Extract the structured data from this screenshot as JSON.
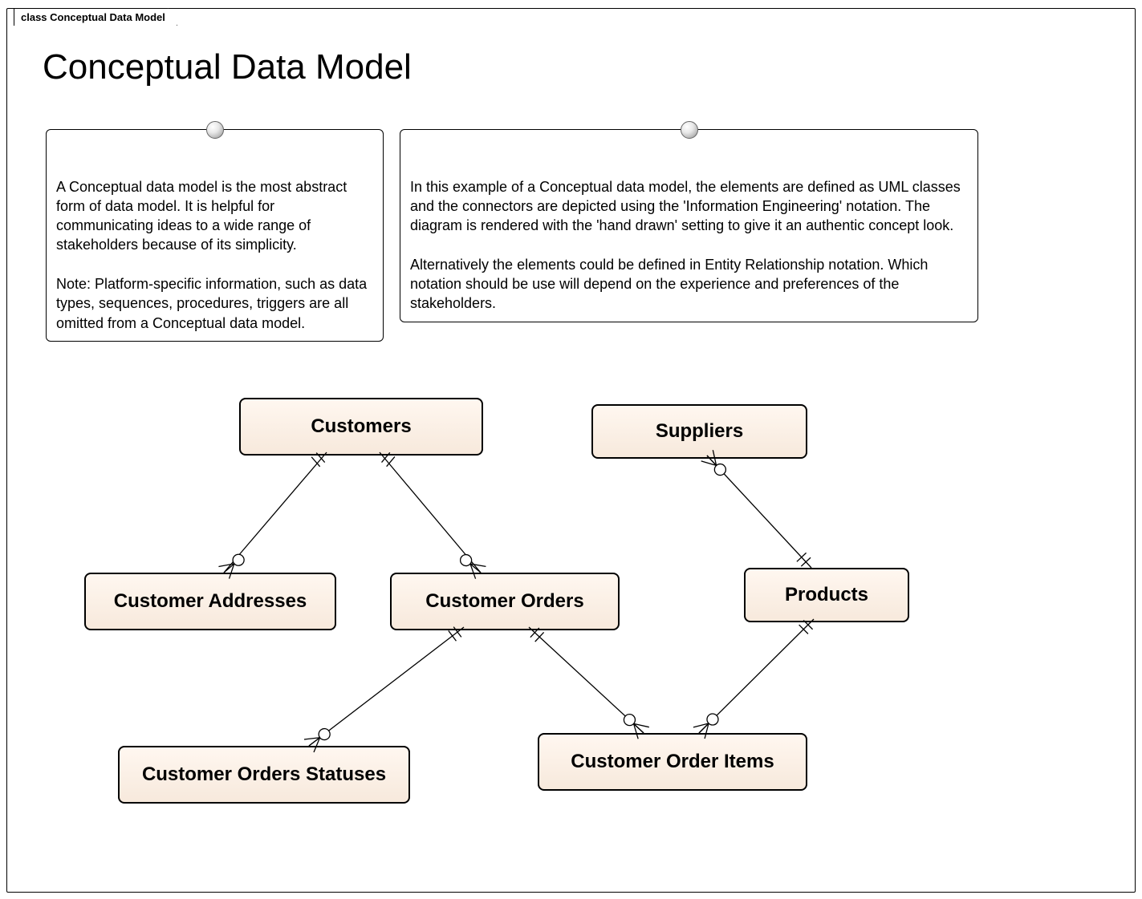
{
  "diagram": {
    "tab_label": "class Conceptual Data Model",
    "title": "Conceptual Data Model",
    "notes": {
      "left": "A Conceptual data model is the most abstract form of data model. It is helpful for communicating ideas to a wide range of stakeholders because of its simplicity.\n\nNote: Platform-specific information, such as data types, sequences, procedures, triggers are all omitted from a Conceptual data model.",
      "right": "In this example of a Conceptual data model, the elements are defined as UML classes and the connectors are depicted using the 'Information Engineering' notation.  The diagram is rendered with the 'hand drawn' setting to give it an authentic concept look.\n\nAlternatively  the elements could be defined in Entity Relationship notation. Which notation should be use will depend on the experience and preferences of the stakeholders."
    },
    "entities": {
      "customers": "Customers",
      "suppliers": "Suppliers",
      "customer_addresses": "Customer Addresses",
      "customer_orders": "Customer Orders",
      "products": "Products",
      "customer_orders_statuses": "Customer Orders Statuses",
      "customer_order_items": "Customer Order Items"
    },
    "relationships": [
      {
        "from": "customers",
        "to": "customer_addresses",
        "from_card": "one",
        "to_card": "zero-or-many"
      },
      {
        "from": "customers",
        "to": "customer_orders",
        "from_card": "one",
        "to_card": "zero-or-many"
      },
      {
        "from": "suppliers",
        "to": "products",
        "from_card": "zero-or-many",
        "to_card": "one"
      },
      {
        "from": "customer_orders",
        "to": "customer_orders_statuses",
        "from_card": "one",
        "to_card": "zero-or-many"
      },
      {
        "from": "customer_orders",
        "to": "customer_order_items",
        "from_card": "one",
        "to_card": "zero-or-many"
      },
      {
        "from": "products",
        "to": "customer_order_items",
        "from_card": "one",
        "to_card": "zero-or-many"
      }
    ]
  }
}
